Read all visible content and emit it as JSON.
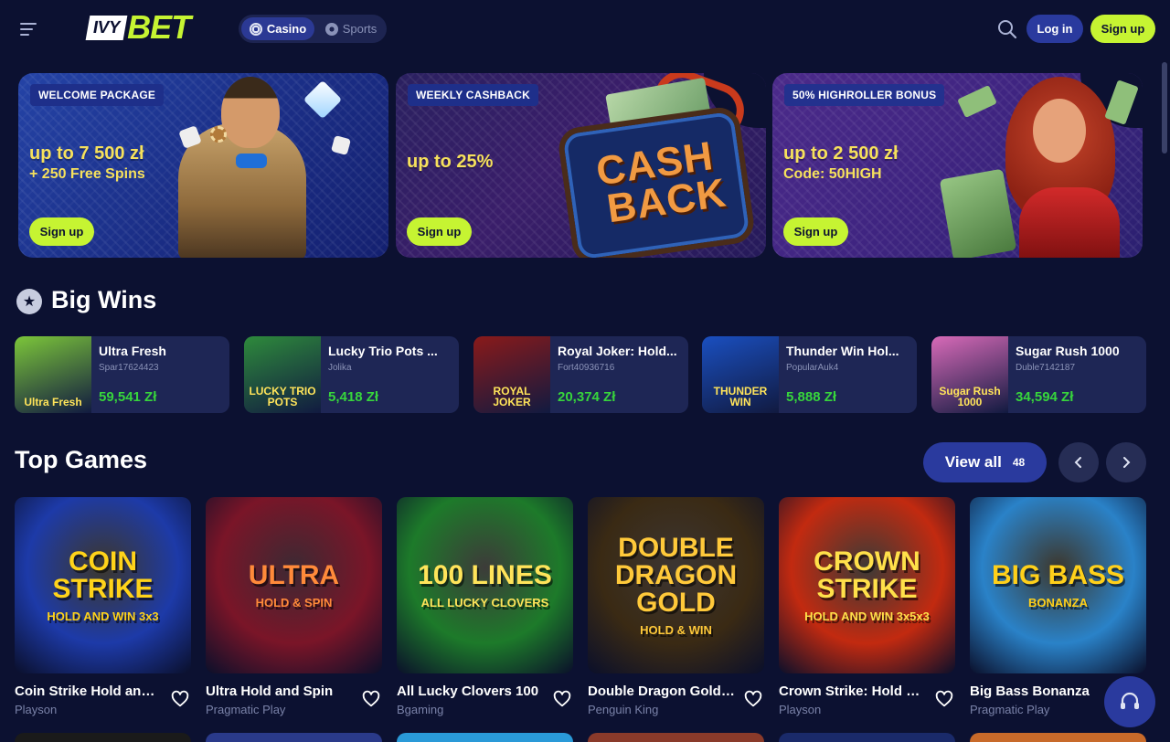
{
  "header": {
    "logo_ivy": "IVY",
    "logo_bet": "BET",
    "switch": {
      "casino": "Casino",
      "sports": "Sports"
    },
    "login": "Log in",
    "signup": "Sign up"
  },
  "banners": [
    {
      "tag": "WELCOME PACKAGE",
      "amount": "up to 7 500 zł",
      "sub": "+ 250 Free Spins",
      "cta": "Sign up"
    },
    {
      "tag": "WEEKLY CASHBACK",
      "amount": "up to 25%",
      "sub": "",
      "cta": "Sign up",
      "art_line1": "CASH",
      "art_line2": "BACK"
    },
    {
      "tag": "50% HIGHROLLER BONUS",
      "amount": "up to 2 500 zł",
      "sub": "Code: 50HIGH",
      "cta": "Sign up"
    }
  ],
  "big_wins": {
    "title": "Big Wins",
    "items": [
      {
        "game": "Ultra Fresh",
        "user": "Spar17624423",
        "amount": "59,541 Zł",
        "thumb_text": "Ultra Fresh",
        "thumb_color": "#7cc63a"
      },
      {
        "game": "Lucky Trio Pots ...",
        "user": "Jolika",
        "amount": "5,418 Zł",
        "thumb_text": "LUCKY TRIO POTS",
        "thumb_color": "#2e8a3c"
      },
      {
        "game": "Royal Joker: Hold...",
        "user": "Fort40936716",
        "amount": "20,374 Zł",
        "thumb_text": "ROYAL JOKER",
        "thumb_color": "#8a1a1a"
      },
      {
        "game": "Thunder Win Hol...",
        "user": "PopularAuk4",
        "amount": "5,888 Zł",
        "thumb_text": "THUNDER WIN",
        "thumb_color": "#1a4fc0"
      },
      {
        "game": "Sugar Rush 1000",
        "user": "Duble7142187",
        "amount": "34,594 Zł",
        "thumb_text": "Sugar Rush 1000",
        "thumb_color": "#d86ab8"
      }
    ]
  },
  "top_games": {
    "title": "Top Games",
    "view_all": "View all",
    "count": "48",
    "items": [
      {
        "name": "Coin Strike Hold and ...",
        "provider": "Playson",
        "art": "COIN STRIKE",
        "art_sub": "HOLD AND WIN 3x3",
        "bg": "#1d3aa8",
        "fg": "#ffd31a"
      },
      {
        "name": "Ultra Hold and Spin",
        "provider": "Pragmatic Play",
        "art": "ULTRA",
        "art_sub": "HOLD & SPIN",
        "bg": "#7a1528",
        "fg": "#ff8a3a"
      },
      {
        "name": "All Lucky Clovers 100",
        "provider": "Bgaming",
        "art": "100 LINES",
        "art_sub": "ALL LUCKY CLOVERS",
        "bg": "#1d7a2a",
        "fg": "#ffe45a"
      },
      {
        "name": "Double Dragon Gold: ...",
        "provider": "Penguin King",
        "art": "DOUBLE DRAGON GOLD",
        "art_sub": "HOLD & WIN",
        "bg": "#3a2a14",
        "fg": "#ffc93a"
      },
      {
        "name": "Crown Strike: Hold an...",
        "provider": "Playson",
        "art": "CROWN STRIKE",
        "art_sub": "HOLD AND WIN 3x5x3",
        "bg": "#c22a10",
        "fg": "#ffe04a"
      },
      {
        "name": "Big Bass Bonanza",
        "provider": "Pragmatic Play",
        "art": "BIG BASS",
        "art_sub": "BONANZA",
        "bg": "#2a82c8",
        "fg": "#ffd01a"
      }
    ]
  },
  "colors": {
    "accent": "#c6f432",
    "primary": "#2a3a9e",
    "bg": "#0c1131",
    "win_green": "#37d53c",
    "promo_yellow": "#f6e15c"
  },
  "icons": {
    "menu": "menu-icon",
    "search": "search-icon",
    "star": "star-icon",
    "heart": "heart-icon",
    "support": "headset-icon"
  }
}
